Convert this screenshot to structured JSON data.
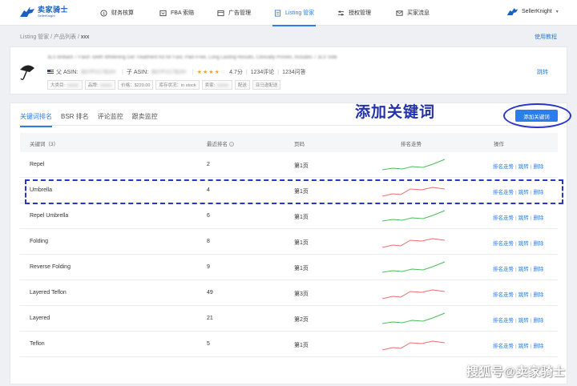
{
  "brand": {
    "name_cn": "卖家骑士",
    "name_en": "SellerKnight"
  },
  "nav": {
    "items": [
      {
        "label": "财务核算",
        "icon": "coin-icon"
      },
      {
        "label": "FBA 索赔",
        "icon": "fba-icon"
      },
      {
        "label": "广告管理",
        "icon": "ad-icon"
      },
      {
        "label": "Listing 管家",
        "icon": "listing-icon",
        "active": true
      },
      {
        "label": "授权管理",
        "icon": "auth-icon"
      },
      {
        "label": "买家流息",
        "icon": "message-icon"
      }
    ],
    "user": "SellerKnight",
    "accent": "#2b7de9"
  },
  "breadcrumb": {
    "part1": "Listing 管家",
    "part2": "产品列表",
    "current": "xxx",
    "sep": "/"
  },
  "help_link": "使用教程",
  "product": {
    "title": "3LS Brilliant 7 Flash Teeth Whitening Gel Treatment Kit for Fast, Pain-Free, Long Lasting Results, Clinically Proven, Includes 7 3LS Vide",
    "parent_asin_label": "父 ASIN:",
    "parent_asin": "B07FV17B2H",
    "child_asin_label": "子 ASIN:",
    "child_asin": "B07FV17B2H",
    "rating_stars": "★★★★",
    "rating_half": "☆",
    "rating": "4.7分",
    "reviews": "1234评论",
    "qa": "1234问答",
    "tags": {
      "category_label": "大类目:",
      "category": "xxxxx",
      "brand_label": "品牌:",
      "brand": "xxxxx",
      "price": "价格：$220.00",
      "stock": "库存状况：in stock",
      "seller_label": "卖家:",
      "seller": "xxxxx",
      "fulfillment": "配送",
      "fba": "亚马逊配送"
    },
    "jump": "跳转"
  },
  "tabs": [
    "关键词排名",
    "BSR 排名",
    "评论监控",
    "跟卖监控"
  ],
  "annotation": "添加关键词",
  "add_button": "添加关键词",
  "table": {
    "headers": {
      "keyword": "关键词（3）",
      "rank": "最近排名",
      "page": "页码",
      "trend": "排名走势",
      "ops": "操作"
    },
    "rows": [
      {
        "keyword": "Repel",
        "rank": "2",
        "page": "第1页",
        "trend": "up"
      },
      {
        "keyword": "Umbrella",
        "rank": "4",
        "page": "第1页",
        "trend": "down"
      },
      {
        "keyword": "Repel Umbrella",
        "rank": "6",
        "page": "第1页",
        "trend": "up"
      },
      {
        "keyword": "Folding",
        "rank": "8",
        "page": "第1页",
        "trend": "down"
      },
      {
        "keyword": "Reverse Folding",
        "rank": "9",
        "page": "第1页",
        "trend": "up"
      },
      {
        "keyword": "Layered Teflon",
        "rank": "49",
        "page": "第3页",
        "trend": "down"
      },
      {
        "keyword": "Layered",
        "rank": "21",
        "page": "第2页",
        "trend": "up"
      },
      {
        "keyword": "Teflon",
        "rank": "5",
        "page": "第1页",
        "trend": "down"
      }
    ],
    "op_trend": "排名走势",
    "op_jump": "跳转",
    "op_delete": "删除",
    "op_sep": "|"
  },
  "colors": {
    "trend_up": "#4cbe5c",
    "trend_down": "#ee6e6e",
    "annotation": "#2a35c8"
  },
  "watermark": "搜狐号@卖家骑士"
}
